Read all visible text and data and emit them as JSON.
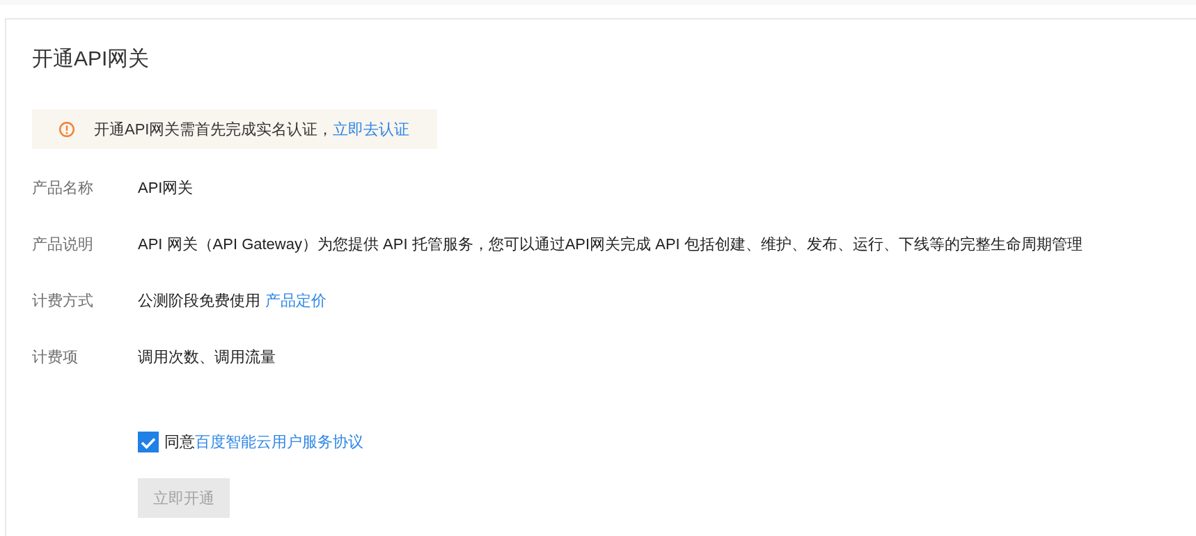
{
  "page": {
    "title": "开通API网关"
  },
  "notice": {
    "text": "开通API网关需首先完成实名认证，",
    "link": "立即去认证"
  },
  "fields": [
    {
      "label": "产品名称",
      "value": "API网关"
    },
    {
      "label": "产品说明",
      "value": "API 网关（API Gateway）为您提供 API 托管服务，您可以通过API网关完成 API 包括创建、维护、发布、运行、下线等的完整生命周期管理"
    },
    {
      "label": "计费方式",
      "value": "公测阶段免费使用",
      "link": "产品定价"
    },
    {
      "label": "计费项",
      "value": "调用次数、调用流量"
    }
  ],
  "agreement": {
    "checked": true,
    "text": "同意",
    "link": "百度智能云用户服务协议"
  },
  "submit": {
    "label": "立即开通",
    "disabled": true
  }
}
